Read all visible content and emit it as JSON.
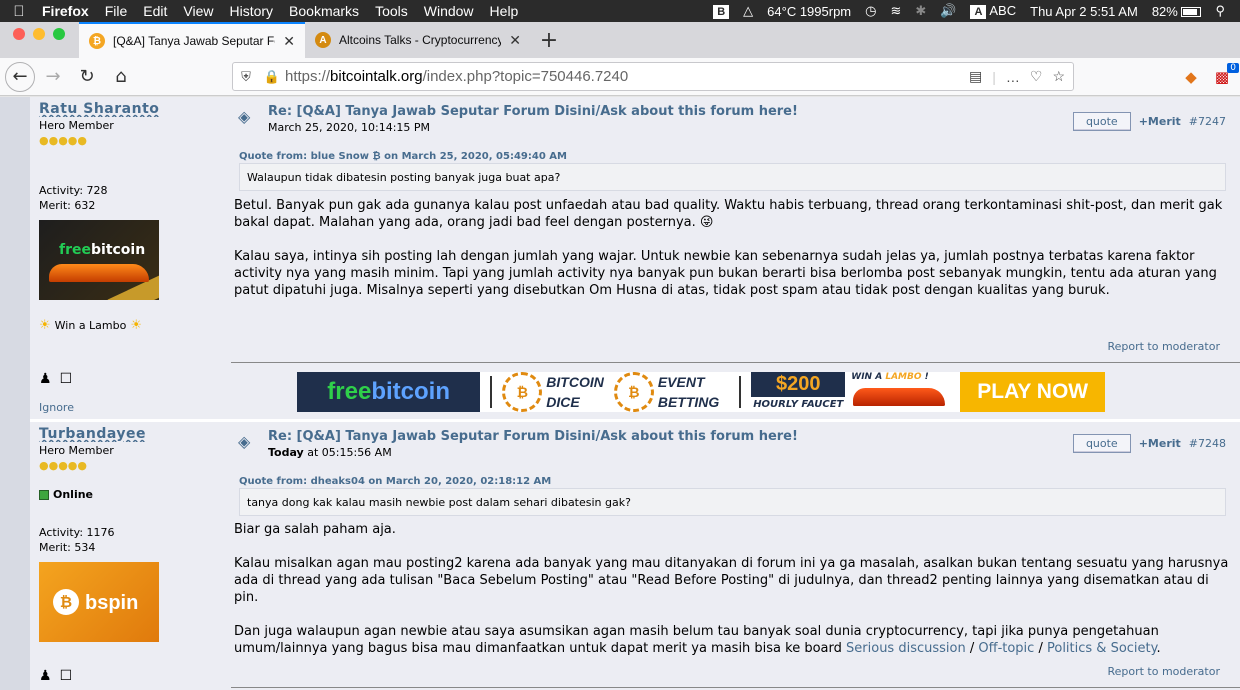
{
  "menubar": {
    "app": "Firefox",
    "items": [
      "File",
      "Edit",
      "View",
      "History",
      "Bookmarks",
      "Tools",
      "Window",
      "Help"
    ],
    "status": {
      "temp": "64°C 1995rpm",
      "input": "ABC",
      "datetime": "Thu Apr 2  5:51 AM",
      "battery": "82%"
    }
  },
  "tabs": [
    {
      "title": "[Q&A] Tanya Jawab Seputar Forum",
      "active": true
    },
    {
      "title": "Altcoins Talks - Cryptocurrency",
      "active": false
    }
  ],
  "navbar": {
    "url_prefix": "https://",
    "url_domain": "bitcointalk.org",
    "url_rest": "/index.php?topic=750446.7240",
    "ext_badge": "0"
  },
  "posts": [
    {
      "poster": {
        "name": "Ratu Sharanto",
        "rank": "Hero Member",
        "stars": "●●●●●",
        "activity": "Activity: 728",
        "merit": "Merit: 632",
        "avatar_logo_a": "free",
        "avatar_logo_b": "bitcoin",
        "personal_text": "Win a Lambo",
        "ignore": "Ignore"
      },
      "subject": "Re: [Q&A] Tanya Jawab Seputar Forum Disini/Ask about this forum here!",
      "date": "March 25, 2020, 10:14:15 PM",
      "quote_label": "quote",
      "merit_label": "+Merit",
      "number": "#7247",
      "quote_header": "Quote from: blue Snow ₿ on March 25, 2020, 05:49:40 AM",
      "quote_text": "Walaupun tidak dibatesin posting banyak juga buat apa?",
      "paragraphs": [
        "Betul. Banyak pun gak ada gunanya kalau post unfaedah atau bad quality. Waktu habis terbuang, thread orang terkontaminasi shit-post, dan merit gak bakal dapat. Malahan yang ada, orang jadi bad feel dengan posternya.  😜",
        "Kalau saya, intinya sih posting lah dengan jumlah yang wajar. Untuk newbie kan sebenarnya sudah jelas ya, jumlah postnya terbatas karena faktor activity nya yang masih minim. Tapi yang jumlah activity nya banyak pun bukan berarti bisa berlomba post sebanyak mungkin, tentu ada aturan yang patut dipatuhi juga. Misalnya seperti yang disebutkan Om Husna di atas, tidak post spam atau tidak post dengan kualitas yang buruk."
      ],
      "report": "Report to moderator"
    },
    {
      "poster": {
        "name": "Turbandayee",
        "rank": "Hero Member",
        "stars": "●●●●●",
        "status": "Online",
        "activity": "Activity: 1176",
        "merit": "Merit: 534",
        "avatar_coin": "₿",
        "avatar_logo": "bspin"
      },
      "subject": "Re: [Q&A] Tanya Jawab Seputar Forum Disini/Ask about this forum here!",
      "date_bold": "Today",
      "date_rest": " at 05:15:56 AM",
      "quote_label": "quote",
      "merit_label": "+Merit",
      "number": "#7248",
      "quote_header": "Quote from: dheaks04 on March 20, 2020, 02:18:12 AM",
      "quote_text": "tanya dong kak kalau masih newbie post dalam sehari dibatesin gak?",
      "p1": "Biar ga salah paham aja.",
      "p2": "Kalau misalkan agan mau posting2 karena ada banyak yang mau ditanyakan di forum ini ya ga masalah, asalkan bukan tentang sesuatu yang harusnya ada di thread yang ada tulisan \"Baca Sebelum Posting\" atau \"Read Before Posting\" di judulnya, dan thread2 penting lainnya yang disematkan atau di pin.",
      "p3_text": "Dan juga walaupun agan newbie atau saya asumsikan agan masih belum tau banyak soal dunia cryptocurrency, tapi jika punya pengetahuan umum/lainnya yang bagus bisa mau dimanfaatkan untuk dapat merit ya masih bisa ke board ",
      "link1": "Serious discussion",
      "sep1": " / ",
      "link2": "Off-topic",
      "sep2": " / ",
      "link3": "Politics & Society",
      "tail": ".",
      "report": "Report to moderator"
    }
  ],
  "banner": {
    "fb_a": "free",
    "fb_b": "bitcoin",
    "coin1": "₿",
    "dice_l1": "BITCOIN",
    "dice_l2": "DICE",
    "coin2": "₿",
    "bet_l1": "EVENT",
    "bet_l2": "BETTING",
    "faucet_amount": "$200",
    "faucet_label": "HOURLY FAUCET",
    "lambo_a": "WIN A ",
    "lambo_b": "LAMBO",
    "lambo_c": " !",
    "play": "PLAY NOW"
  }
}
